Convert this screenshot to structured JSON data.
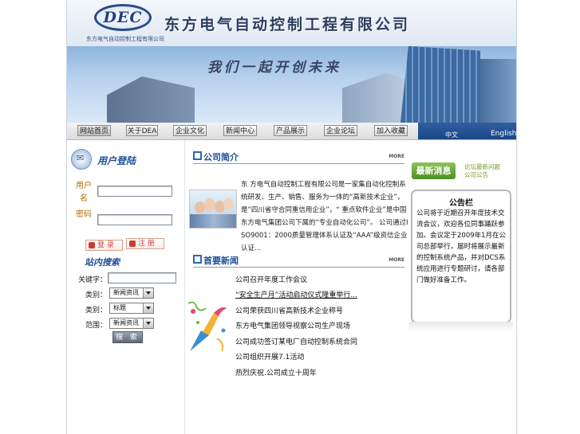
{
  "header": {
    "logo_text": "DEC",
    "logo_subtitle": "东方电气自动控制工程有限公司",
    "company_name": "东方电气自动控制工程有限公司"
  },
  "banner": {
    "slogan": "我们一起开创未来"
  },
  "nav": {
    "items": [
      "网站首页",
      "关于DEA",
      "企业文化",
      "新闻中心",
      "产品展示",
      "企业论坛",
      "加入收藏"
    ],
    "lang_cn": "中文",
    "lang_en": "English"
  },
  "login": {
    "title": "用户登陆",
    "username_label": "用户名",
    "password_label": "密码",
    "login_button": "登 录",
    "register_button": "注 册"
  },
  "search": {
    "title": "站内搜索",
    "keyword_label": "关键字：",
    "type_label": "类别：",
    "category_label": "类别：",
    "field_label": "范围：",
    "select1": "新闻资讯",
    "select2": "标题",
    "select3": "新闻资讯",
    "button": "搜 索"
  },
  "intro": {
    "title": "公司简介",
    "more": "MORE",
    "text": "东 方电气自动控制工程有限公司是一家集自动化控制系统研发、生产、销售、服务为一体的“高新技术企业”，是“四川省守合同重信用企业”，“ 重点软件企业”是中国东方电气集团公司下属的“专业自动化公司”。 公司通过ISO9001：2000质量管理体系认证及“AAA”级资信企业认证..."
  },
  "news": {
    "title": "首要新闻",
    "more": "MORE",
    "items": [
      "公司召开年度工作会议",
      "“安全生产月”活动启动仪式隆重举行...",
      "公司荣获四川省高新技术企业称号",
      "东方电气集团领导视察公司生产现场",
      "公司成功签订某电厂自动控制系统合同",
      "公司组织开展7.1活动",
      "热烈庆祝.公司成立十周年"
    ]
  },
  "latest": {
    "badge": "最新消息",
    "link1": "论坛最新问题",
    "link2": "公司公告"
  },
  "notice": {
    "title": "公告栏",
    "body": "公司将于近期召开年度技术交流会议，欢迎各位同事踊跃参加。会议定于2009年1月在公司总部举行，届时将展示最新的控制系统产品，并对DCS系统应用进行专题研讨，请各部门做好准备工作。"
  },
  "colors": {
    "brand_blue": "#1f4f98",
    "nav_lang_bg": "#1b4685",
    "latest_green": "#4d8f22",
    "label_orange": "#b07000"
  }
}
